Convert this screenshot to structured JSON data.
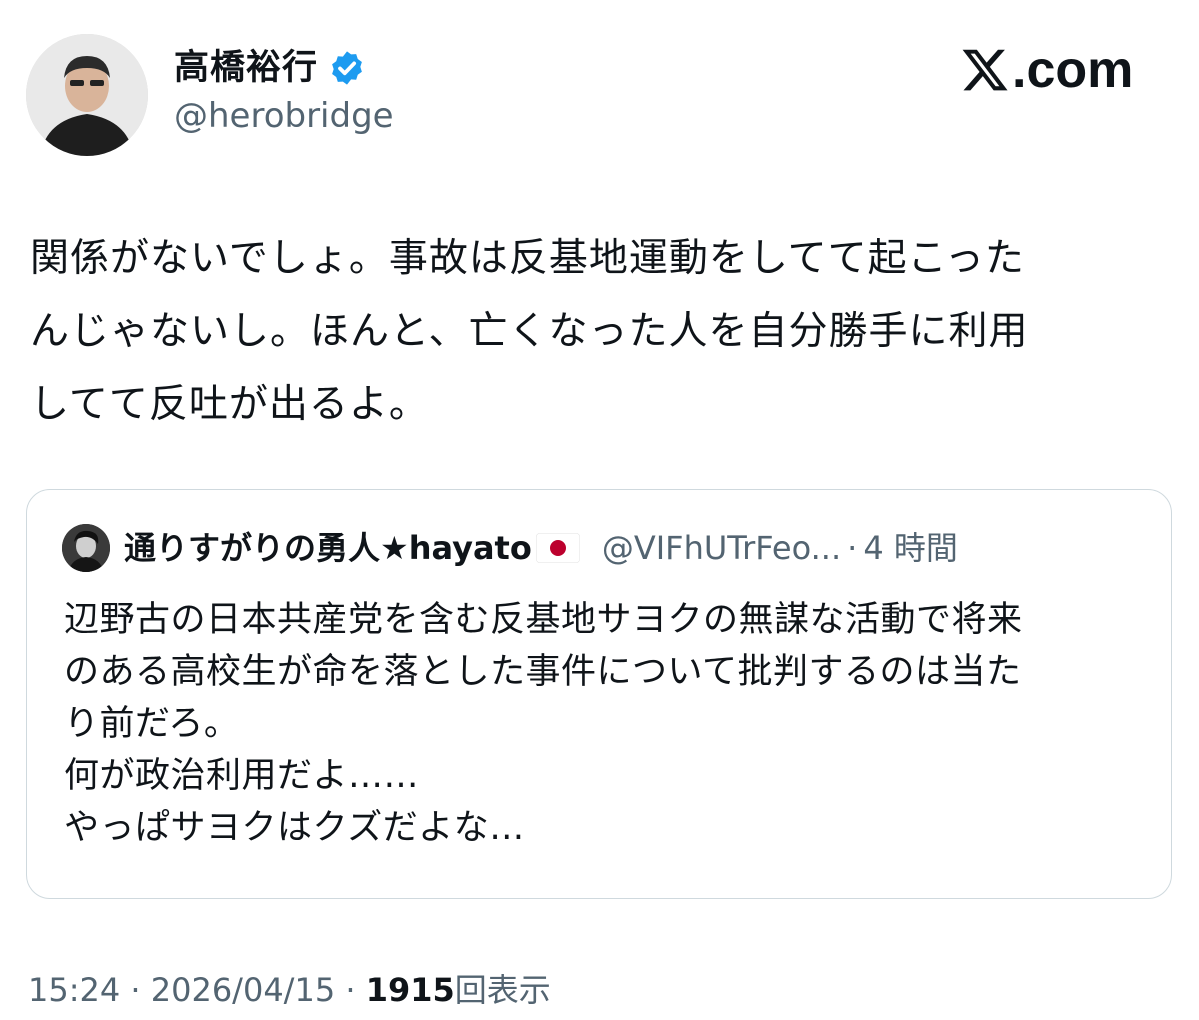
{
  "header": {
    "display_name": "高橋裕行",
    "handle": "@herobridge",
    "brand_text": ".com",
    "icons": {
      "avatar": "profile-photo",
      "verified": "verified-badge-icon",
      "brand": "x-logo-icon"
    },
    "colors": {
      "verified": "#1d9bf0",
      "secondary_text": "#536471",
      "primary_text": "#0f1419"
    }
  },
  "tweet": {
    "lines": [
      "関係がないでしょ。事故は反基地運動をしてて起こった",
      "んじゃないし。ほんと、亡くなった人を自分勝手に利用",
      "してて反吐が出るよ。"
    ]
  },
  "quote": {
    "name": "通りすがりの勇人★hayato",
    "flag": "japan-flag-emoji",
    "handle": "@VIFhUTrFeo...",
    "dot": "·",
    "time": "4 時間",
    "lines": [
      "辺野古の日本共産党を含む反基地サヨクの無謀な活動で将来",
      "のある高校生が命を落とした事件について批判するのは当た",
      "り前だろ。",
      "何が政治利用だよ……",
      "やっぱサヨクはクズだよな…"
    ]
  },
  "meta": {
    "time": "15:24",
    "sep1": "·",
    "date": "2026/04/15",
    "sep2": "·",
    "views_count": "1915",
    "views_label": "回表示"
  }
}
